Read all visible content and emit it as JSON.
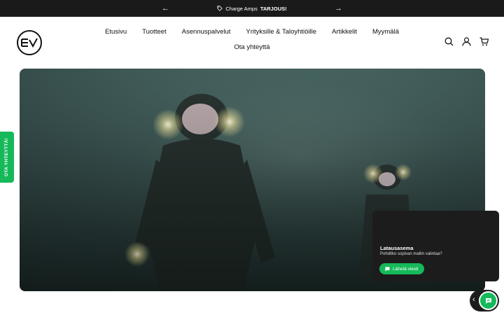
{
  "announcement": {
    "prev_icon": "arrow-left-icon",
    "next_icon": "arrow-right-icon",
    "tag_icon": "tag-icon",
    "text": "Charge Amps",
    "highlight": "TARJOUS!"
  },
  "header": {
    "logo_icon": "ev-logo",
    "nav": [
      "Etusivu",
      "Tuotteet",
      "Asennuspalvelut",
      "Yrityksille & Taloyhtiöille",
      "Artikkelit",
      "Myymälä",
      "Ota yhteyttä"
    ],
    "icons": [
      "search-icon",
      "account-icon",
      "cart-icon"
    ]
  },
  "side_tab": {
    "label": "OTA YHTEYTTÄ!"
  },
  "chat": {
    "title": "Latausasema",
    "subtitle": "Pohditko sopivan mallin valintaa?",
    "button_label": "Lähetä viesti",
    "button_icon": "chat-icon",
    "toggle_icon": "chevron-left-icon",
    "bubble_icon": "chat-icon"
  },
  "colors": {
    "accent": "#16b95a",
    "dark": "#1c1c1c"
  }
}
